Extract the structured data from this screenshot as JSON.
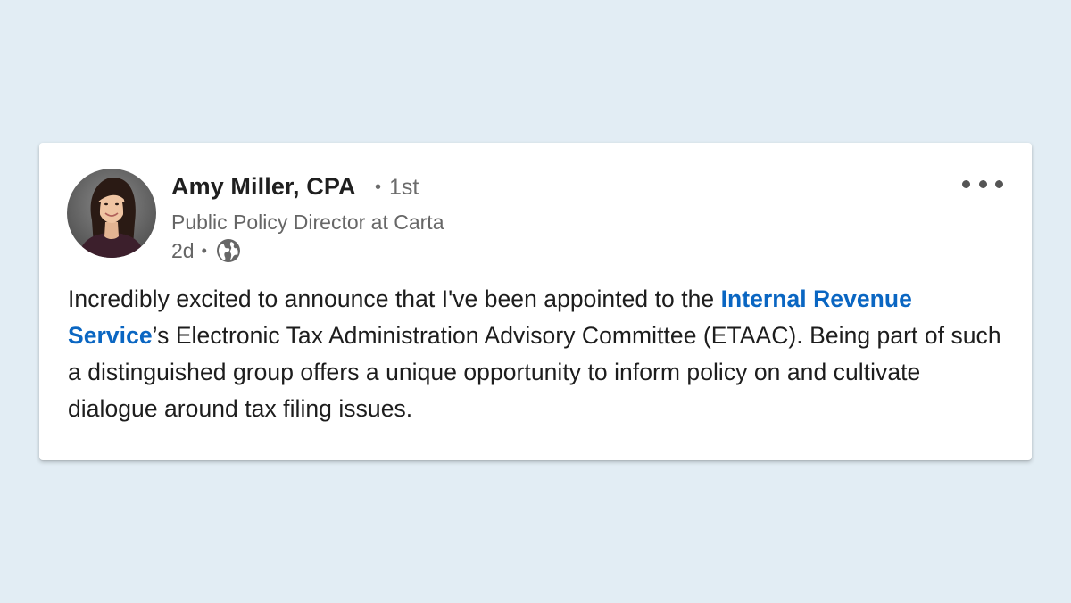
{
  "post": {
    "author": {
      "name": "Amy Miller, CPA",
      "connection_dot": "•",
      "connection_degree": "1st",
      "headline": "Public Policy Director at Carta",
      "avatar_icon": "profile-photo"
    },
    "meta": {
      "time": "2d",
      "separator": "•",
      "visibility_icon": "globe-icon"
    },
    "menu_icon": "more-horizontal-icon",
    "body": {
      "text_1": "Incredibly excited to announce that I've been appointed to the ",
      "mention": "Internal Revenue Service",
      "text_2": "’s Electronic Tax Administration Advisory Committee (ETAAC). Being part of such a distinguished group offers a unique opportunity to inform policy on and cultivate dialogue around tax filing issues."
    }
  },
  "colors": {
    "page_background": "#e2edf4",
    "card_background": "#ffffff",
    "mention_link": "#0a66c2",
    "secondary_text": "#666666",
    "primary_text": "#1d1d1d"
  }
}
